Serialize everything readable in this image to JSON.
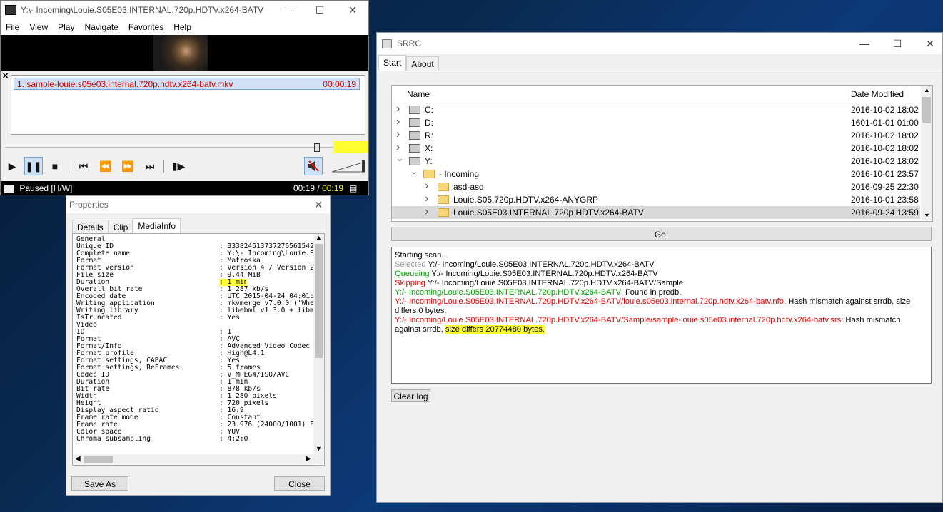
{
  "mpc": {
    "title": "Y:\\- Incoming\\Louie.S05E03.INTERNAL.720p.HDTV.x264-BATV\\S...",
    "menu": [
      "File",
      "View",
      "Play",
      "Navigate",
      "Favorites",
      "Help"
    ],
    "playlist": {
      "item": "1. sample-louie.s05e03.internal.720p.hdtv.x264-batv.mkv",
      "duration": "00:00:19"
    },
    "status": "Paused [H/W]",
    "time_current": "00:19",
    "time_separator": "/",
    "time_total": "00:19",
    "seek_fraction": 0.95
  },
  "props": {
    "title": "Properties",
    "tabs": [
      "Details",
      "Clip",
      "MediaInfo"
    ],
    "active_tab": "MediaInfo",
    "rows": [
      {
        "k": "General",
        "v": ""
      },
      {
        "k": "Unique ID",
        "v": ": 333824513737276561542"
      },
      {
        "k": "Complete name",
        "v": ": Y:\\- Incoming\\Louie.S("
      },
      {
        "k": "Format",
        "v": ": Matroska"
      },
      {
        "k": "Format version",
        "v": ": Version 4 / Version 2"
      },
      {
        "k": "File size",
        "v": ": 9.44 MiB"
      },
      {
        "k": "Duration",
        "v": ": 1 min"
      },
      {
        "k": "Overall bit rate",
        "v": ": 1 287 kb/s"
      },
      {
        "k": "Encoded date",
        "v": ": UTC 2015-04-24 04:01:1"
      },
      {
        "k": "Writing application",
        "v": ": mkvmerge v7.0.0 ('When"
      },
      {
        "k": "Writing library",
        "v": ": libebml v1.3.0 + libma"
      },
      {
        "k": "IsTruncated",
        "v": ": Yes"
      },
      {
        "k": "",
        "v": ""
      },
      {
        "k": "Video",
        "v": ""
      },
      {
        "k": "ID",
        "v": ": 1"
      },
      {
        "k": "Format",
        "v": ": AVC"
      },
      {
        "k": "Format/Info",
        "v": ": Advanced Video Codec"
      },
      {
        "k": "Format profile",
        "v": ": High@L4.1"
      },
      {
        "k": "Format settings, CABAC",
        "v": ": Yes"
      },
      {
        "k": "Format settings, ReFrames",
        "v": ": 5 frames"
      },
      {
        "k": "Codec ID",
        "v": ": V_MPEG4/ISO/AVC"
      },
      {
        "k": "Duration",
        "v": ": 1 min"
      },
      {
        "k": "Bit rate",
        "v": ": 878 kb/s"
      },
      {
        "k": "Width",
        "v": ": 1 280 pixels"
      },
      {
        "k": "Height",
        "v": ": 720 pixels"
      },
      {
        "k": "Display aspect ratio",
        "v": ": 16:9"
      },
      {
        "k": "Frame rate mode",
        "v": ": Constant"
      },
      {
        "k": "Frame rate",
        "v": ": 23.976 (24000/1001) FP"
      },
      {
        "k": "Color space",
        "v": ": YUV"
      },
      {
        "k": "Chroma subsampling",
        "v": ": 4:2:0"
      }
    ],
    "save_as": "Save As",
    "close": "Close"
  },
  "srrc": {
    "title": "SRRC",
    "tabs": [
      "Start",
      "About"
    ],
    "col_name": "Name",
    "col_date": "Date Modified",
    "tree": [
      {
        "name": "C:",
        "date": "2016-10-02 18:02",
        "level": 0,
        "expanded": false,
        "icon": "drive-icon"
      },
      {
        "name": "D:",
        "date": "1601-01-01 01:00",
        "level": 0,
        "expanded": false,
        "icon": "cdrom-icon"
      },
      {
        "name": "R:",
        "date": "2016-10-02 18:02",
        "level": 0,
        "expanded": false,
        "icon": "drive-icon"
      },
      {
        "name": "X:",
        "date": "2016-10-02 18:02",
        "level": 0,
        "expanded": false,
        "icon": "network-drive-icon"
      },
      {
        "name": "Y:",
        "date": "2016-10-02 18:02",
        "level": 0,
        "expanded": true,
        "icon": "network-drive-icon"
      },
      {
        "name": "- Incoming",
        "date": "2016-10-01 23:57",
        "level": 1,
        "expanded": true,
        "icon": "folder-icon"
      },
      {
        "name": "asd-asd",
        "date": "2016-09-25 22:30",
        "level": 2,
        "expanded": false,
        "icon": "folder-icon"
      },
      {
        "name": "Louie.S05.720p.HDTV.x264-ANYGRP",
        "date": "2016-10-01 23:58",
        "level": 2,
        "expanded": false,
        "icon": "folder-icon"
      },
      {
        "name": "Louie.S05E03.INTERNAL.720p.HDTV.x264-BATV",
        "date": "2016-09-24 13:59",
        "level": 2,
        "expanded": false,
        "icon": "folder-icon",
        "selected": true
      }
    ],
    "go": "Go!",
    "log": {
      "l1": "Starting scan...",
      "l2a": "Selected",
      "l2b": " Y:/- Incoming/Louie.S05E03.INTERNAL.720p.HDTV.x264-BATV",
      "l3a": "Queueing",
      "l3b": " Y:/- Incoming/Louie.S05E03.INTERNAL.720p.HDTV.x264-BATV",
      "l4a": "Skipping",
      "l4b": " Y:/- Incoming/Louie.S05E03.INTERNAL.720p.HDTV.x264-BATV/Sample",
      "l5a": "Y:/- Incoming/Louie.S05E03.INTERNAL.720p.HDTV.x264-BATV:",
      "l5b": " Found in predb.",
      "l6a": "Y:/- Incoming/Louie.S05E03.INTERNAL.720p.HDTV.x264-BATV/louie.s05e03.internal.720p.hdtv.x264-batv.nfo:",
      "l6b": " Hash mismatch against srrdb, size differs 0 bytes.",
      "l7a": "Y:/- Incoming/Louie.S05E03.INTERNAL.720p.HDTV.x264-BATV/Sample/sample-louie.s05e03.internal.720p.hdtv.x264-batv.srs:",
      "l7b": " Hash mismatch against srrdb, ",
      "l7c": "size differs 20774480 bytes."
    },
    "clear_log": "Clear log"
  }
}
